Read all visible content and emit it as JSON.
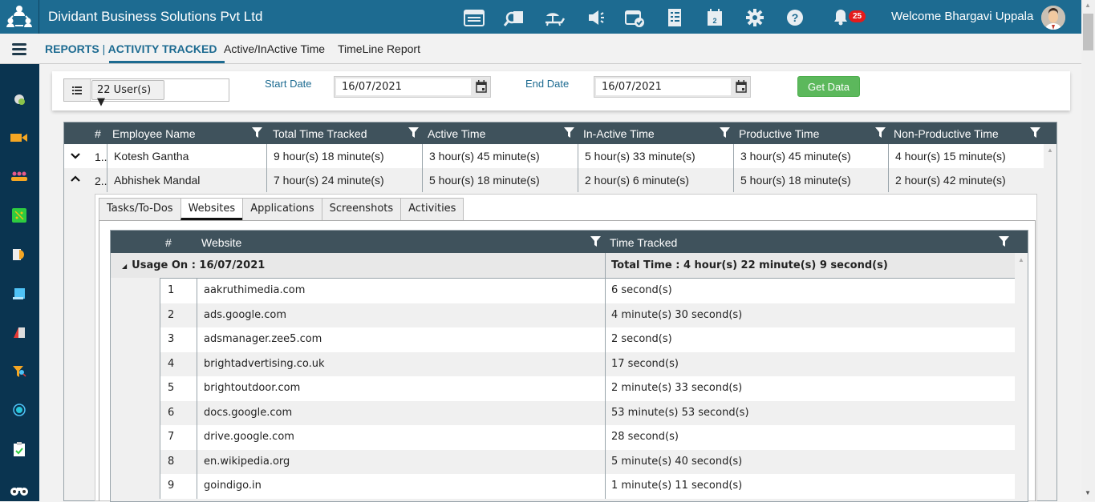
{
  "header": {
    "app_title": "Dividant Business Solutions Pvt Ltd",
    "top_icons": [
      "timesheet-icon",
      "search-document-icon",
      "leave-icon",
      "announcement-icon",
      "calendar-check-icon",
      "checklist-icon",
      "calendar-icon",
      "gear-icon",
      "help-icon"
    ],
    "notification_count": "25",
    "welcome_text": "Welcome Bhargavi Uppala"
  },
  "subnav": {
    "section": "REPORTS",
    "separator": "|",
    "active": "ACTIVITY TRACKED",
    "links": [
      "Active/InActive Time",
      "TimeLine Report"
    ]
  },
  "sidebar": {
    "icons": [
      "settings-icon",
      "video-icon",
      "team-icon",
      "network-icon",
      "document-clock-icon",
      "notes-icon",
      "book-icon",
      "filter-search-icon",
      "target-icon",
      "clipboard-check-icon",
      "binoculars-icon"
    ]
  },
  "filters": {
    "users_selected": "22 User(s) ▼",
    "start_date_label": "Start Date",
    "start_date_value": "16/07/2021",
    "end_date_label": "End Date",
    "end_date_value": "16/07/2021",
    "get_data_label": "Get Data"
  },
  "grid": {
    "columns": [
      "#",
      "Employee Name",
      "Total Time Tracked",
      "Active Time",
      "In-Active Time",
      "Productive Time",
      "Non-Productive Time"
    ],
    "rows": [
      {
        "num": "1..",
        "name": "Kotesh Gantha",
        "total": "9 hour(s) 18 minute(s)",
        "active": "3 hour(s) 45 minute(s)",
        "inactive": "5 hour(s) 33 minute(s)",
        "productive": "3 hour(s) 45 minute(s)",
        "nonproductive": "4 hour(s) 15 minute(s)",
        "expanded": false
      },
      {
        "num": "2..",
        "name": "Abhishek Mandal",
        "total": "7 hour(s) 24 minute(s)",
        "active": "5 hour(s) 18 minute(s)",
        "inactive": "2 hour(s) 6 minute(s)",
        "productive": "5 hour(s) 18 minute(s)",
        "nonproductive": "2 hour(s) 42 minute(s)",
        "expanded": true
      }
    ]
  },
  "detail": {
    "tabs": [
      "Tasks/To-Dos",
      "Websites",
      "Applications",
      "Screenshots",
      "Activities"
    ],
    "active_tab": "Websites",
    "websites": {
      "columns": [
        "#",
        "Website",
        "Time Tracked"
      ],
      "group_label": "Usage On : 16/07/2021",
      "group_total": "Total Time : 4 hour(s) 22 minute(s) 9 second(s)",
      "rows": [
        {
          "n": "1",
          "site": "aakruthimedia.com",
          "time": "6 second(s)"
        },
        {
          "n": "2",
          "site": "ads.google.com",
          "time": "4 minute(s) 30 second(s)"
        },
        {
          "n": "3",
          "site": "adsmanager.zee5.com",
          "time": "2 second(s)"
        },
        {
          "n": "4",
          "site": "brightadvertising.co.uk",
          "time": "17 second(s)"
        },
        {
          "n": "5",
          "site": "brightoutdoor.com",
          "time": "2 minute(s) 33 second(s)"
        },
        {
          "n": "6",
          "site": "docs.google.com",
          "time": "53 minute(s) 53 second(s)"
        },
        {
          "n": "7",
          "site": "drive.google.com",
          "time": "28 second(s)"
        },
        {
          "n": "8",
          "site": "en.wikipedia.org",
          "time": "5 minute(s) 40 second(s)"
        },
        {
          "n": "9",
          "site": "goindigo.in",
          "time": "1 minute(s) 11 second(s)"
        }
      ]
    }
  }
}
